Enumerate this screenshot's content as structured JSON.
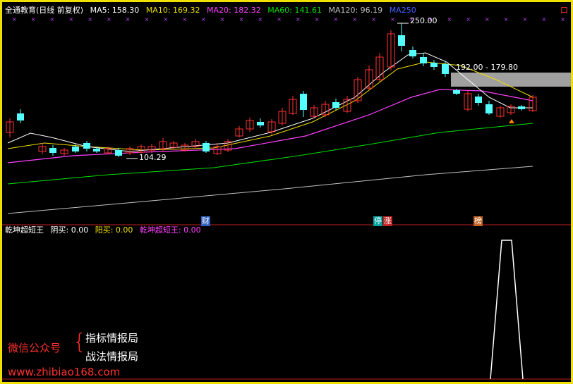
{
  "header": {
    "title": "全通教育(日线 前复权)",
    "ma5": "MA5: 158.30",
    "ma10": "MA10: 169.32",
    "ma20": "MA20: 182.32",
    "ma60": "MA60: 141.61",
    "ma120": "MA120: 96.19",
    "ma250": "MA250",
    "corner": "口"
  },
  "price_labels": {
    "high": "250.00",
    "low": "104.29",
    "range": "192.00 - 179.80"
  },
  "markers": {
    "cai": "财",
    "ting": "停",
    "zhang": "涨",
    "bang": "榜"
  },
  "indicator": {
    "name": "乾坤超短王",
    "yin_mai": "阴买: 0.00",
    "yang_mai": "阳买: 0.00",
    "value": "乾坤超短王: 0.00"
  },
  "watermark": {
    "wechat": "微信公众号",
    "line1": "指标情报局",
    "line2": "战法情报局",
    "url": "www.zhibiao168.com"
  },
  "colors": {
    "up": "#ff3232",
    "down": "#54ffff",
    "ma5": "#ffffff",
    "ma10": "#f0e000",
    "ma20": "#ff40ff",
    "ma60": "#00e000",
    "ma120": "#c0c0c0",
    "ma250": "#4060ff"
  }
}
